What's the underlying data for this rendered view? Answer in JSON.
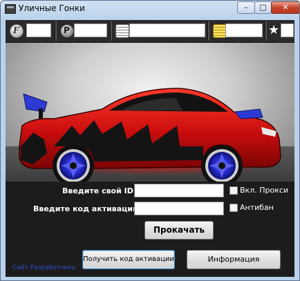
{
  "window": {
    "title": "Уличные Гонки",
    "controls": {
      "minimize": "–",
      "maximize": "□",
      "close": "✕"
    }
  },
  "stats_bar": {
    "items": [
      {
        "icon": "f-coin-icon",
        "glyph": "F",
        "value": ""
      },
      {
        "icon": "p-coin-icon",
        "glyph": "P",
        "value": ""
      },
      {
        "icon": "silver-coins-icon",
        "glyph": "",
        "value": ""
      },
      {
        "icon": "gold-coins-icon",
        "glyph": "",
        "value": ""
      },
      {
        "icon": "star-icon",
        "glyph": "★",
        "value": ""
      }
    ]
  },
  "form": {
    "id_label": "Введите свой ID:",
    "id_value": "",
    "code_label": "Введите код активации:",
    "code_value": "",
    "proxy_label": "Вкл. Прокси",
    "antiban_label": "Антибан",
    "upgrade_button": "Прокачать",
    "get_code_button": "Получить код активации",
    "info_button": "Информация",
    "dev_site_link": "Сайт Разработчика"
  },
  "colors": {
    "car_body": "#d11515",
    "car_dark": "#1a1a1a",
    "rims": "#2b2fd6",
    "spoiler": "#2d3bd4",
    "link": "#2b4fd1"
  }
}
